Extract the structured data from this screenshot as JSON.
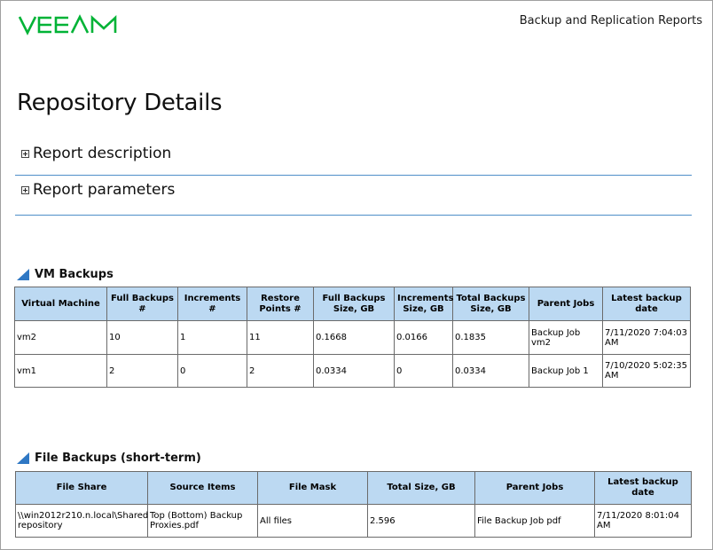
{
  "header": {
    "logo_text": "veeam",
    "report_suite": "Backup and Replication Reports",
    "colors": {
      "logo_green": "#00b336",
      "accent_blue": "#2f78c4",
      "header_fill": "#bcd9f2"
    }
  },
  "page": {
    "title": "Repository Details"
  },
  "expanders": [
    {
      "label": "Report description",
      "icon": "plus-box-icon"
    },
    {
      "label": "Report parameters",
      "icon": "plus-box-icon"
    }
  ],
  "vm_backups": {
    "title": "VM Backups",
    "columns": [
      "Virtual Machine",
      "Full Backups #",
      "Increments #",
      "Restore Points #",
      "Full Backups Size, GB",
      "Increments Size, GB",
      "Total Backups Size, GB",
      "Parent Jobs",
      "Latest backup date"
    ],
    "rows": [
      [
        "vm2",
        "10",
        "1",
        "11",
        "0.1668",
        "0.0166",
        "0.1835",
        "Backup Job vm2",
        "7/11/2020 7:04:03 AM"
      ],
      [
        "vm1",
        "2",
        "0",
        "2",
        "0.0334",
        "0",
        "0.0334",
        "Backup Job 1",
        "7/10/2020 5:02:35 AM"
      ]
    ]
  },
  "file_backups": {
    "title": "File Backups (short-term)",
    "columns": [
      "File Share",
      "Source Items",
      "File Mask",
      "Total Size, GB",
      "Parent Jobs",
      "Latest backup date"
    ],
    "rows": [
      [
        "\\\\win2012r210.n.local\\Shared repository",
        "Top (Bottom) Backup Proxies.pdf",
        "All files",
        "2.596",
        "File Backup Job pdf",
        "7/11/2020 8:01:04 AM"
      ]
    ]
  }
}
